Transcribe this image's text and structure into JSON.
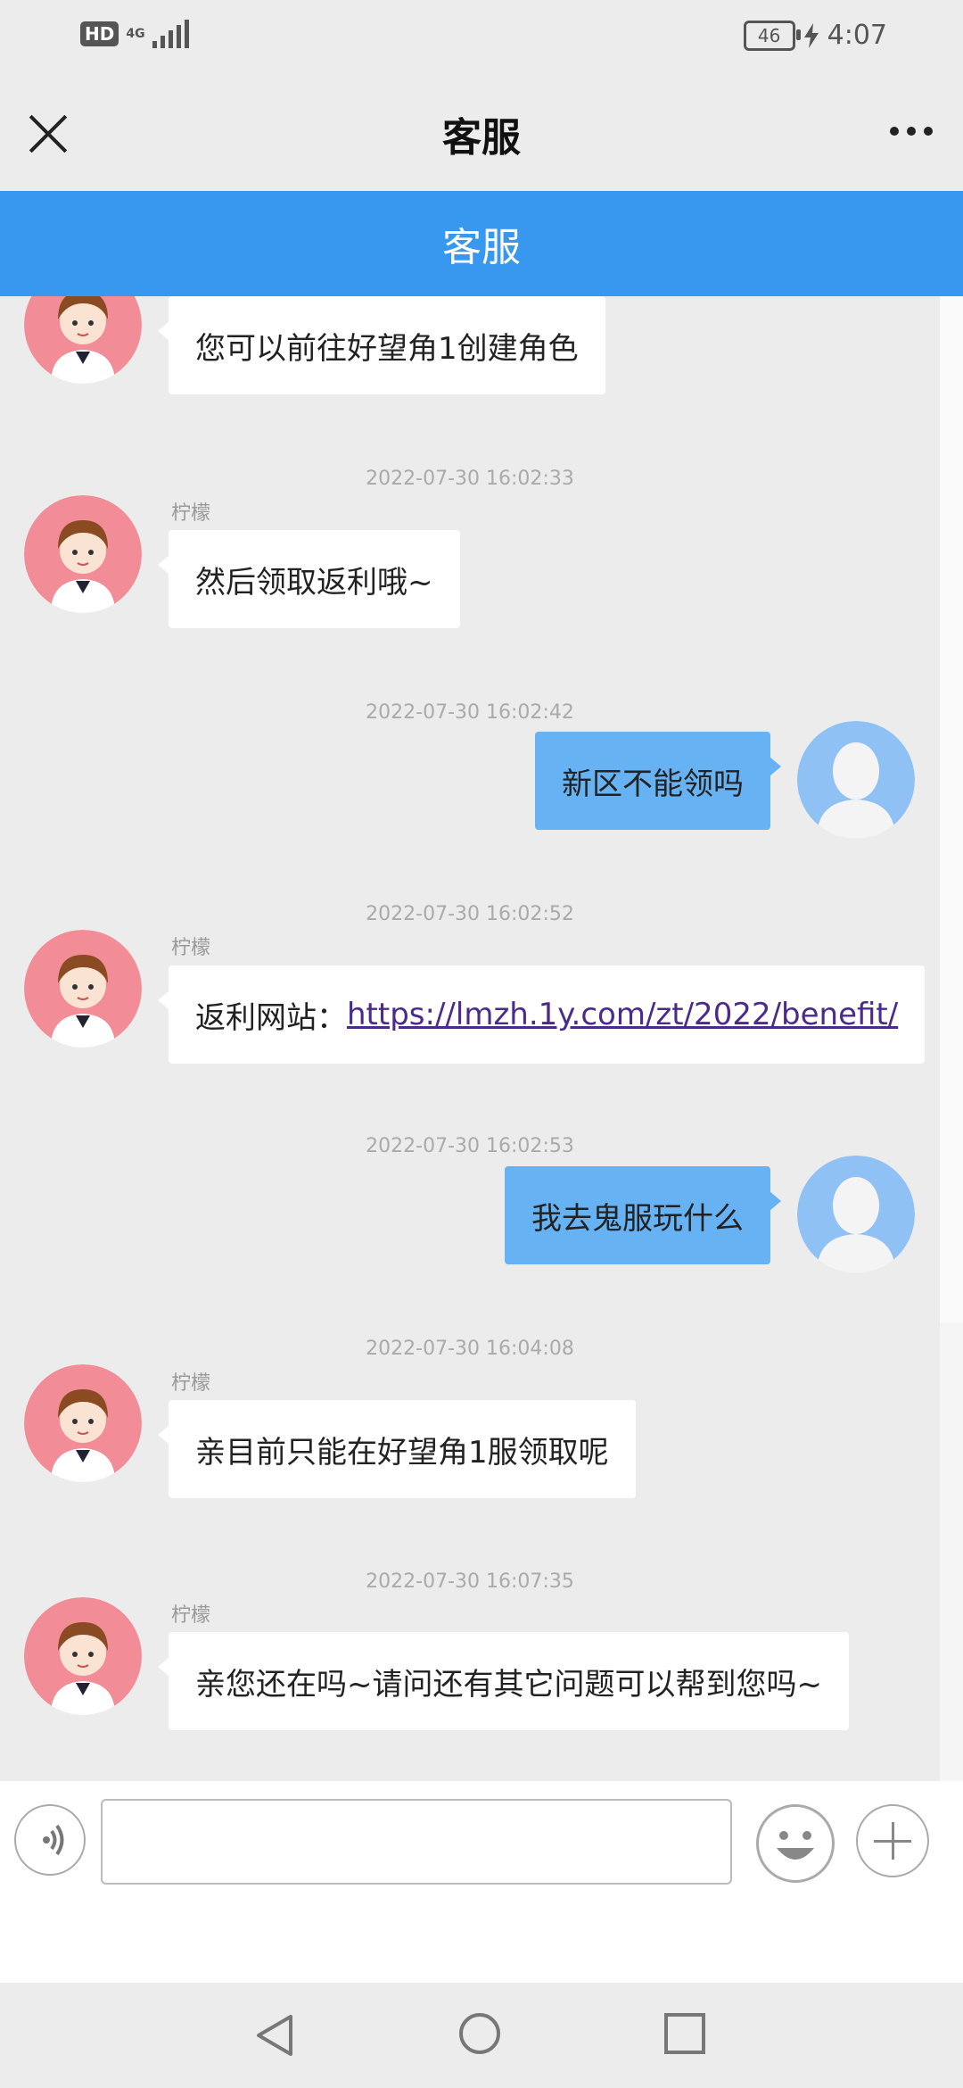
{
  "status_bar": {
    "hd": "HD",
    "network": "4G",
    "battery": "46",
    "time": "4:07"
  },
  "header": {
    "title": "客服",
    "close_icon": "close-icon",
    "more_icon": "more-icon"
  },
  "banner": {
    "title": "客服"
  },
  "messages": [
    {
      "side": "left",
      "text": "您可以前往好望角1创建角色"
    },
    {
      "timestamp": "2022-07-30  16:02:33",
      "side": "left",
      "sender": "柠檬",
      "text": "然后领取返利哦~"
    },
    {
      "timestamp": "2022-07-30  16:02:42",
      "side": "right",
      "text": "新区不能领吗"
    },
    {
      "timestamp": "2022-07-30  16:02:52",
      "side": "left",
      "sender": "柠檬",
      "text_prefix": "返利网站：",
      "link": "https://lmzh.1y.com/zt/2022/benefit/"
    },
    {
      "timestamp": "2022-07-30  16:02:53",
      "side": "right",
      "text": "我去鬼服玩什么"
    },
    {
      "timestamp": "2022-07-30  16:04:08",
      "side": "left",
      "sender": "柠檬",
      "text": "亲目前只能在好望角1服领取呢"
    },
    {
      "timestamp": "2022-07-30  16:07:35",
      "side": "left",
      "sender": "柠檬",
      "text": "亲您还在吗~请问还有其它问题可以帮到您吗~"
    }
  ],
  "input": {
    "placeholder": ""
  },
  "colors": {
    "banner": "#3897ef",
    "user_bubble": "#67b2f3",
    "agent_avatar_bg": "#f28c96",
    "user_avatar_bg": "#8fc1f5"
  }
}
